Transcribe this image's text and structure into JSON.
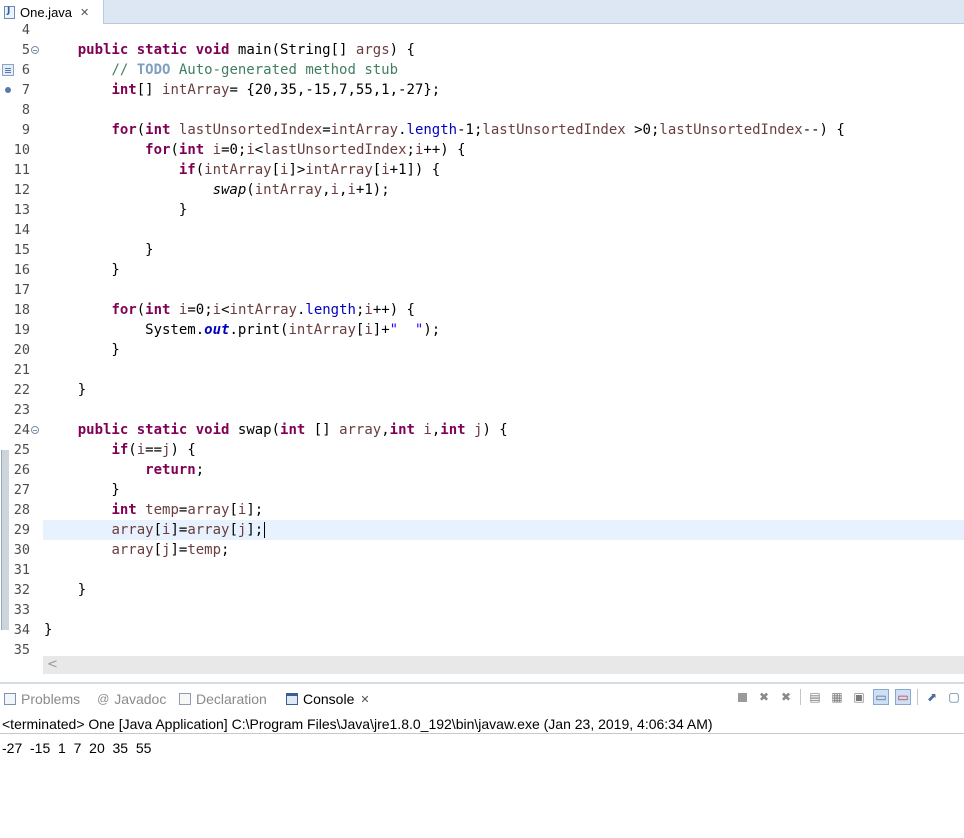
{
  "editor": {
    "tab_title": "One.java",
    "current_line": 29,
    "lines": [
      {
        "n": "4",
        "html": ""
      },
      {
        "n": "5",
        "fold": true,
        "html": "    <span class=\"kw\">public</span> <span class=\"kw\">static</span> <span class=\"kw\">void</span> main(String[] <span class=\"var\">args</span>) {"
      },
      {
        "n": "6",
        "task": true,
        "html": "        <span class=\"cm\">// </span><span class=\"todo\">TODO</span><span class=\"cm\"> Auto-generated method stub</span>"
      },
      {
        "n": "7",
        "dot": true,
        "html": "        <span class=\"kw\">int</span>[] <span class=\"var\">intArray</span>= {20,35,-15,7,55,1,-27};"
      },
      {
        "n": "8",
        "html": ""
      },
      {
        "n": "9",
        "html": "        <span class=\"kw\">for</span>(<span class=\"kw\">int</span> <span class=\"var\">lastUnsortedIndex</span>=<span class=\"var\">intArray</span>.<span class=\"fld\">length</span>-1;<span class=\"var\">lastUnsortedIndex</span> &gt;0;<span class=\"var\">lastUnsortedIndex</span>--) {"
      },
      {
        "n": "10",
        "html": "            <span class=\"kw\">for</span>(<span class=\"kw\">int</span> <span class=\"var\">i</span>=0;<span class=\"var\">i</span>&lt;<span class=\"var\">lastUnsortedIndex</span>;<span class=\"var\">i</span>++) {"
      },
      {
        "n": "11",
        "html": "                <span class=\"kw\">if</span>(<span class=\"var\">intArray</span>[<span class=\"var\">i</span>]&gt;<span class=\"var\">intArray</span>[<span class=\"var\">i</span>+1]) {"
      },
      {
        "n": "12",
        "html": "                    <span class=\"smeth\">swap</span>(<span class=\"var\">intArray</span>,<span class=\"var\">i</span>,<span class=\"var\">i</span>+1);"
      },
      {
        "n": "13",
        "html": "                }"
      },
      {
        "n": "14",
        "html": ""
      },
      {
        "n": "15",
        "html": "            }"
      },
      {
        "n": "16",
        "html": "        }"
      },
      {
        "n": "17",
        "html": ""
      },
      {
        "n": "18",
        "html": "        <span class=\"kw\">for</span>(<span class=\"kw\">int</span> <span class=\"var\">i</span>=0;<span class=\"var\">i</span>&lt;<span class=\"var\">intArray</span>.<span class=\"fld\">length</span>;<span class=\"var\">i</span>++) {"
      },
      {
        "n": "19",
        "html": "            System.<span class=\"sfld\">out</span>.print(<span class=\"var\">intArray</span>[<span class=\"var\">i</span>]+<span class=\"str\">\"  \"</span>);"
      },
      {
        "n": "20",
        "html": "        }"
      },
      {
        "n": "21",
        "html": ""
      },
      {
        "n": "22",
        "html": "    }"
      },
      {
        "n": "23",
        "html": ""
      },
      {
        "n": "24",
        "fold": true,
        "html": "    <span class=\"kw\">public</span> <span class=\"kw\">static</span> <span class=\"kw\">void</span> swap(<span class=\"kw\">int</span> [] <span class=\"var\">array</span>,<span class=\"kw\">int</span> <span class=\"var\">i</span>,<span class=\"kw\">int</span> <span class=\"var\">j</span>) {"
      },
      {
        "n": "25",
        "html": "        <span class=\"kw\">if</span>(<span class=\"var\">i</span>==<span class=\"var\">j</span>) {"
      },
      {
        "n": "26",
        "html": "            <span class=\"kw\">return</span>;"
      },
      {
        "n": "27",
        "html": "        }"
      },
      {
        "n": "28",
        "html": "        <span class=\"kw\">int</span> <span class=\"var\">temp</span>=<span class=\"var\">array</span>[<span class=\"var\">i</span>];"
      },
      {
        "n": "29",
        "html": "        <span class=\"var\">array</span>[<span class=\"var\">i</span>]=<span class=\"var\">array</span>[<span class=\"var\">j</span>];<span class=\"caret\"></span>"
      },
      {
        "n": "30",
        "html": "        <span class=\"var\">array</span>[<span class=\"var\">j</span>]=<span class=\"var\">temp</span>;"
      },
      {
        "n": "31",
        "html": ""
      },
      {
        "n": "32",
        "html": "    }"
      },
      {
        "n": "33",
        "html": ""
      },
      {
        "n": "34",
        "html": "}"
      },
      {
        "n": "35",
        "html": ""
      }
    ]
  },
  "panel": {
    "tabs": [
      "Problems",
      "Javadoc",
      "Declaration",
      "Console"
    ],
    "javadoc_glyph": "@",
    "status": "<terminated> One [Java Application] C:\\Program Files\\Java\\jre1.8.0_192\\bin\\javaw.exe (Jan 23, 2019, 4:06:34 AM)",
    "output": "-27  -15  1  7  20  35  55"
  },
  "icons": {
    "close": "close-icon",
    "terminate": "terminate-icon",
    "remove_launch": "remove-launch-icon",
    "remove_all": "remove-all-terminated-icon",
    "scroll_lock": "scroll-lock-icon",
    "word_wrap": "word-wrap-icon",
    "pin": "pin-console-icon",
    "show_console_out": "show-console-output-icon",
    "show_console_err": "show-console-error-icon",
    "open_console": "open-console-icon"
  },
  "colors": {
    "keyword": "#7f0055",
    "comment": "#3f7f5f",
    "field": "#0000c0",
    "string": "#2a00ff",
    "current_line": "#e8f2fe"
  }
}
